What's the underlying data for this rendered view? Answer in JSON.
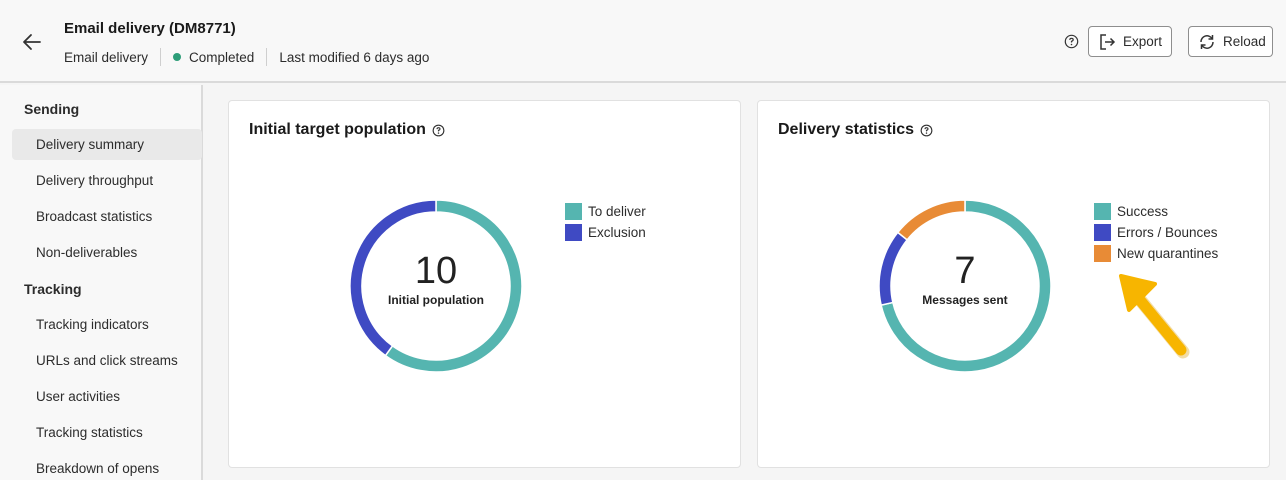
{
  "header": {
    "title": "Email delivery (DM8771)",
    "type": "Email delivery",
    "status": "Completed",
    "modified": "Last modified 6 days ago",
    "export_label": "Export",
    "reload_label": "Reload"
  },
  "sidebar": {
    "sections": [
      {
        "title": "Sending",
        "items": [
          "Delivery summary",
          "Delivery throughput",
          "Broadcast statistics",
          "Non-deliverables"
        ]
      },
      {
        "title": "Tracking",
        "items": [
          "Tracking indicators",
          "URLs and click streams",
          "User activities",
          "Tracking statistics",
          "Breakdown of opens"
        ]
      }
    ],
    "active_item": "Delivery summary"
  },
  "cards": [
    {
      "title": "Initial target population",
      "center_value": "10",
      "center_label": "Initial population",
      "legend": [
        {
          "label": "To deliver",
          "color": "#55b5b0"
        },
        {
          "label": "Exclusion",
          "color": "#3f4ac3"
        }
      ]
    },
    {
      "title": "Delivery statistics",
      "center_value": "7",
      "center_label": "Messages sent",
      "legend": [
        {
          "label": "Success",
          "color": "#55b5b0"
        },
        {
          "label": "Errors / Bounces",
          "color": "#3f4ac3"
        },
        {
          "label": "New quarantines",
          "color": "#e88b36"
        }
      ]
    }
  ],
  "chart_data": [
    {
      "type": "pie",
      "title": "Initial target population",
      "categories": [
        "To deliver",
        "Exclusion"
      ],
      "values": [
        6,
        4
      ],
      "colors": [
        "#55b5b0",
        "#3f4ac3"
      ]
    },
    {
      "type": "pie",
      "title": "Delivery statistics",
      "categories": [
        "Success",
        "Errors / Bounces",
        "New quarantines"
      ],
      "values": [
        5,
        1,
        1
      ],
      "colors": [
        "#55b5b0",
        "#3f4ac3",
        "#e88b36"
      ]
    }
  ]
}
